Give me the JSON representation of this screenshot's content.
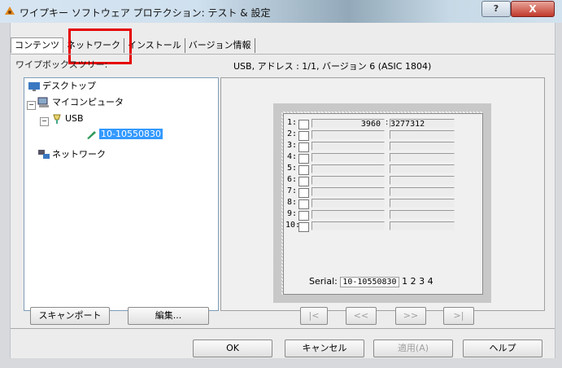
{
  "window": {
    "title": "ワイプキー ソフトウェア プロテクション: テスト & 設定",
    "help_label": "?",
    "close_label": "X"
  },
  "tabs": [
    {
      "label": "コンテンツ",
      "selected": true
    },
    {
      "label": "ネットワーク",
      "selected": false
    },
    {
      "label": "インストール",
      "selected": false
    },
    {
      "label": "バージョン情報",
      "selected": false
    }
  ],
  "tree": {
    "label": "ワイプボックスツリー:",
    "nodes": [
      {
        "label": "デスクトップ"
      },
      {
        "label": "マイコンピュータ"
      },
      {
        "label": "USB"
      },
      {
        "label": "10-10550830"
      },
      {
        "label": "ネットワーク"
      }
    ]
  },
  "device": {
    "info": "USB, アドレス : 1/1, バージョン 6 (ASIC 1804)",
    "slots": [
      {
        "num": "1:",
        "a": "3960",
        "b": "3277312"
      },
      {
        "num": "2:",
        "a": "",
        "b": ""
      },
      {
        "num": "3:",
        "a": "",
        "b": ""
      },
      {
        "num": "4:",
        "a": "",
        "b": ""
      },
      {
        "num": "5:",
        "a": "",
        "b": ""
      },
      {
        "num": "6:",
        "a": "",
        "b": ""
      },
      {
        "num": "7:",
        "a": "",
        "b": ""
      },
      {
        "num": "8:",
        "a": "",
        "b": ""
      },
      {
        "num": "9:",
        "a": "",
        "b": ""
      },
      {
        "num": "10:",
        "a": "",
        "b": ""
      }
    ],
    "serial_label": "Serial:",
    "serial_value": "10-10550830",
    "serial_checks": [
      "1",
      "2",
      "3",
      "4"
    ]
  },
  "buttons": {
    "scan_port": "スキャンポート",
    "edit": "編集...",
    "nav_first": "|<",
    "nav_prev": "<<",
    "nav_next": ">>",
    "nav_last": ">|",
    "ok": "OK",
    "cancel": "キャンセル",
    "apply": "適用(A)",
    "help": "ヘルプ"
  }
}
